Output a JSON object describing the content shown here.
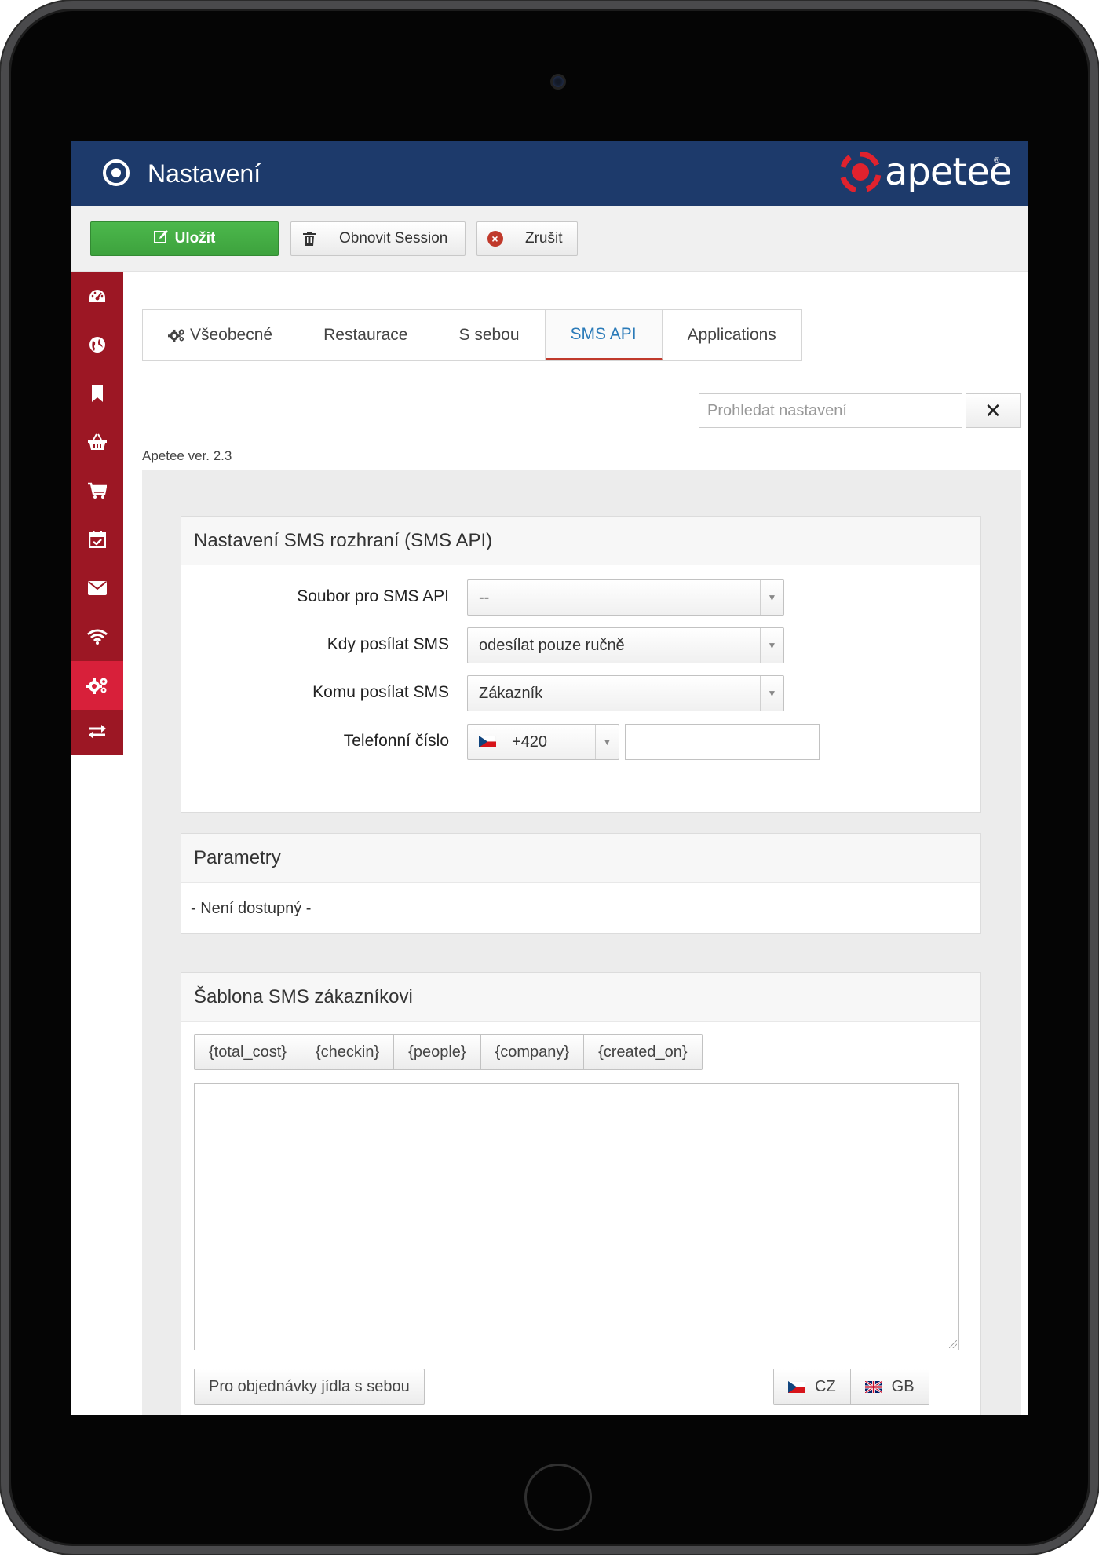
{
  "header": {
    "title": "Nastavení",
    "brand": "apetee",
    "brand_mark": "®"
  },
  "toolbar": {
    "save_label": "Uložit",
    "refresh_label": "Obnovit Session",
    "cancel_label": "Zrušit"
  },
  "sidebar": {
    "items": [
      {
        "icon": "dashboard-icon"
      },
      {
        "icon": "globe-icon"
      },
      {
        "icon": "bookmark-icon"
      },
      {
        "icon": "basket-icon"
      },
      {
        "icon": "cart-icon"
      },
      {
        "icon": "calendar-check-icon"
      },
      {
        "icon": "envelope-icon"
      },
      {
        "icon": "wifi-icon"
      },
      {
        "icon": "gears-icon",
        "active": true
      },
      {
        "icon": "exchange-icon"
      }
    ]
  },
  "tabs": [
    {
      "label": "Všeobecné"
    },
    {
      "label": "Restaurace"
    },
    {
      "label": "S sebou"
    },
    {
      "label": "SMS API",
      "active": true
    },
    {
      "label": "Applications"
    }
  ],
  "search": {
    "placeholder": "Prohledat nastavení",
    "clear": "✕"
  },
  "version": "Apetee ver. 2.3",
  "sms_panel": {
    "title": "Nastavení SMS rozhraní (SMS API)",
    "file_label": "Soubor pro SMS API",
    "file_value": "--",
    "when_label": "Kdy posílat SMS",
    "when_value": "odesílat pouze ručně",
    "to_label": "Komu posílat SMS",
    "to_value": "Zákazník",
    "phone_label": "Telefonní číslo",
    "phone_prefix": "+420",
    "phone_value": ""
  },
  "params_panel": {
    "title": "Parametry",
    "empty_text": "- Není dostupný -"
  },
  "template_panel": {
    "title": "Šablona SMS zákazníkovi",
    "placeholders": [
      "{total_cost}",
      "{checkin}",
      "{people}",
      "{company}",
      "{created_on}"
    ],
    "textarea_value": "",
    "takeaway_label": "Pro objednávky jídla s sebou",
    "languages": [
      "CZ",
      "GB"
    ]
  },
  "colors": {
    "header_bg": "#1d3a6b",
    "sidebar_bg": "#9c1724",
    "sidebar_active": "#d8203a",
    "save_green": "#43a843",
    "tab_active_text": "#2a7ab8",
    "tab_active_border": "#c0392b",
    "brand_red": "#e0222e"
  }
}
